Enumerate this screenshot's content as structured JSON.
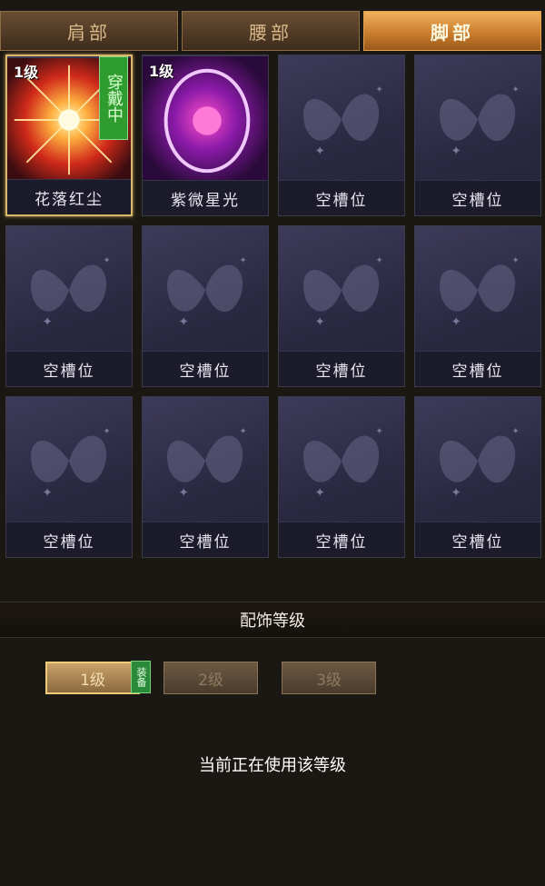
{
  "tabs": [
    {
      "label": "肩部",
      "active": false
    },
    {
      "label": "腰部",
      "active": false
    },
    {
      "label": "脚部",
      "active": true
    }
  ],
  "slots": [
    {
      "name": "花落红尘",
      "level": "1级",
      "worn": "穿戴中",
      "icon": "red-starburst-icon"
    },
    {
      "name": "紫微星光",
      "level": "1级",
      "icon": "purple-orb-icon"
    },
    {
      "name": "空槽位",
      "icon": "butterfly-icon"
    },
    {
      "name": "空槽位",
      "icon": "butterfly-icon"
    },
    {
      "name": "空槽位",
      "icon": "butterfly-icon"
    },
    {
      "name": "空槽位",
      "icon": "butterfly-icon"
    },
    {
      "name": "空槽位",
      "icon": "butterfly-icon"
    },
    {
      "name": "空槽位",
      "icon": "butterfly-icon"
    },
    {
      "name": "空槽位",
      "icon": "butterfly-icon"
    },
    {
      "name": "空槽位",
      "icon": "butterfly-icon"
    },
    {
      "name": "空槽位",
      "icon": "butterfly-icon"
    },
    {
      "name": "空槽位",
      "icon": "butterfly-icon"
    }
  ],
  "section": {
    "title": "配饰等级"
  },
  "levels": [
    {
      "label": "1级",
      "active": true,
      "tag": "装备"
    },
    {
      "label": "2级",
      "active": false
    },
    {
      "label": "3级",
      "active": false
    }
  ],
  "status_text": "当前正在使用该等级",
  "colors": {
    "accent": "#f0b05a",
    "worn_green": "#2e9c2e",
    "slot_bg": "#2b2942"
  }
}
